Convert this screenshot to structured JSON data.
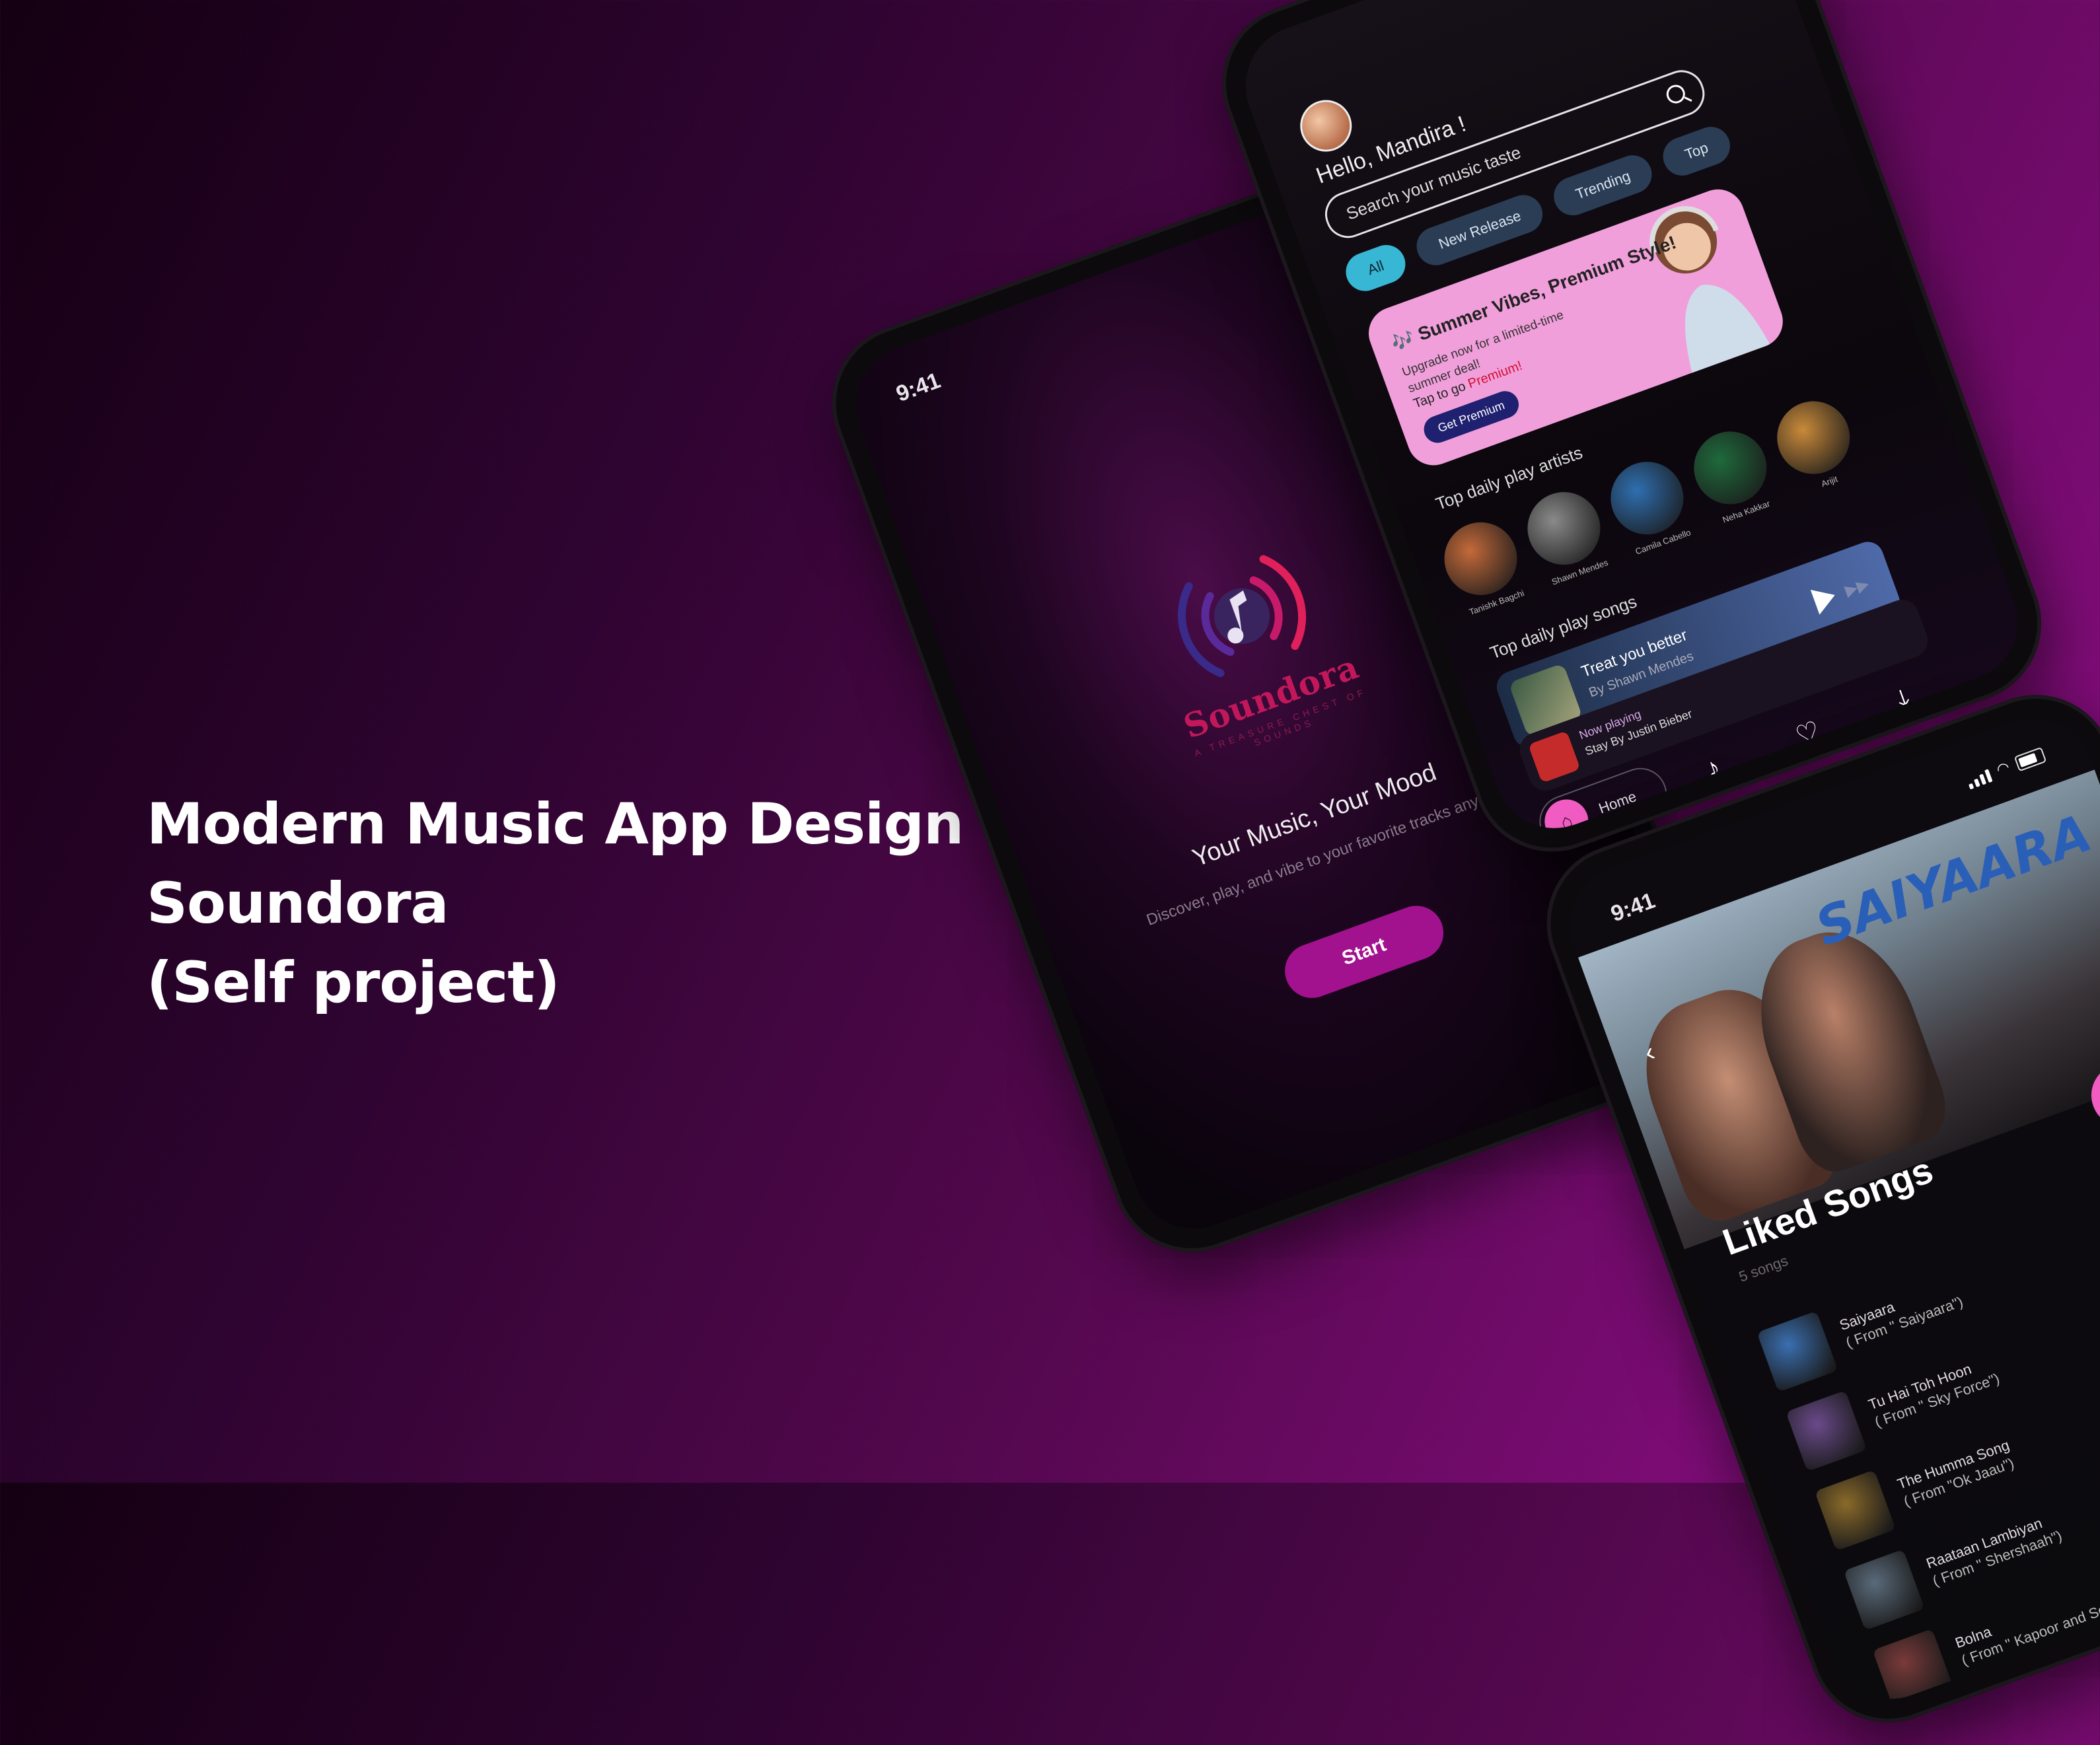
{
  "headline": {
    "line1": "Modern Music App Design -",
    "line2": "Soundora",
    "line3": "(Self project)"
  },
  "colors": {
    "accent_pink": "#f05cc2",
    "start_button": "#a3128e",
    "brand_red": "#c2185b",
    "chip_active": "#37b7d4",
    "promo_bg": "#f19fdb"
  },
  "splash": {
    "time": "9:41",
    "brand": "Soundora",
    "tagline": "A TREASURE CHEST OF SOUNDS",
    "title": "Your Music, Your Mood",
    "subtitle": "Discover, play, and vibe to your favorite tracks anytime.",
    "start_label": "Start",
    "logo_icon": "music-note-waves-icon"
  },
  "home": {
    "greeting": "Hello, Mandira !",
    "search_placeholder": "Search your music taste",
    "chips": [
      "All",
      "New Release",
      "Trending",
      "Top"
    ],
    "promo": {
      "title": "🎶 Summer Vibes, Premium Style!",
      "subtitle": "Upgrade now for a limited-time summer deal!",
      "tap_prefix": "Tap to go ",
      "tap_highlight": "Premium!",
      "button": "Get Premium"
    },
    "artists_title": "Top daily play artists",
    "artists": [
      {
        "name": "Tanishk Bagchi",
        "color": "#c46a3a"
      },
      {
        "name": "Shawn Mendes",
        "color": "#8a8a8a"
      },
      {
        "name": "Camila Cabello",
        "color": "#2f6fb0"
      },
      {
        "name": "Neha Kakkar",
        "color": "#1f6a3c"
      },
      {
        "name": "Arijit",
        "color": "#c98a3a"
      }
    ],
    "songs_title": "Top daily play songs",
    "top_song": {
      "title": "Treat you better",
      "artist": "By Shawn Mendes"
    },
    "now_playing": {
      "label": "Now playing",
      "track": "Stay By Justin Bieber"
    },
    "tabs": {
      "home_label": "Home"
    }
  },
  "liked": {
    "time": "9:41",
    "hero_title": "SAIYAARA",
    "title": "Liked Songs",
    "count": "5 songs",
    "songs": [
      {
        "title": "Saiyaara",
        "sub": "( From \" Saiyaara\")",
        "color": "#3a6fb0"
      },
      {
        "title": "Tu Hai Toh Hoon",
        "sub": "( From \" Sky Force\")",
        "color": "#6a4a8a"
      },
      {
        "title": "The Humma Song",
        "sub": "( From \"Ok Jaau\")",
        "color": "#8a6a2a"
      },
      {
        "title": "Raataan Lambiyan",
        "sub": "( From \" Shershaah\")",
        "color": "#5a6a7a"
      },
      {
        "title": "Bolna",
        "sub": "( From \" Kapoor and Sons\")",
        "color": "#7a3a3a"
      }
    ]
  }
}
